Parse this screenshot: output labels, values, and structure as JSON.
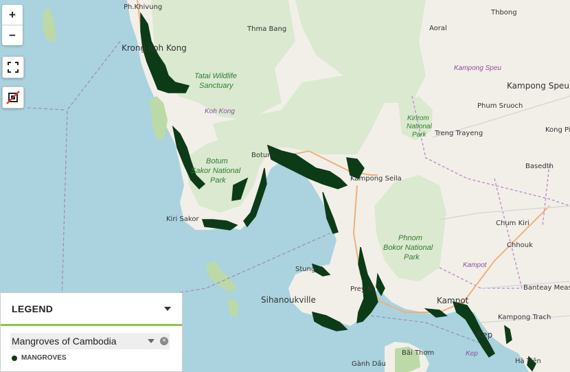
{
  "map": {
    "places": [
      {
        "id": "ph-khivung",
        "label": "Ph.Khivung"
      },
      {
        "id": "thbong",
        "label": "Thbong"
      },
      {
        "id": "thma-bang",
        "label": "Thma Bang"
      },
      {
        "id": "aoral",
        "label": "Aoral"
      },
      {
        "id": "koh-kong-town",
        "label": "Krong Koh Kong"
      },
      {
        "id": "kampong-speu",
        "label": "Kampong Speu"
      },
      {
        "id": "phum-sruoch",
        "label": "Phum Sruoch"
      },
      {
        "id": "treng-trayeng",
        "label": "Treng Trayeng"
      },
      {
        "id": "kong-pisei",
        "label": "Kong Pi"
      },
      {
        "id": "basedth",
        "label": "Basedth"
      },
      {
        "id": "botum",
        "label": "Botum"
      },
      {
        "id": "kampong-seila",
        "label": "Kampong Seila"
      },
      {
        "id": "kiri-sakor",
        "label": "Kiri Sakor"
      },
      {
        "id": "chum-kiri",
        "label": "Chum Kiri"
      },
      {
        "id": "chhouk",
        "label": "Chhouk"
      },
      {
        "id": "stung-hav",
        "label": "Stung H"
      },
      {
        "id": "sihanoukville",
        "label": "Sihanoukville"
      },
      {
        "id": "prey-nob",
        "label": "Prey N"
      },
      {
        "id": "banteay-meas",
        "label": "Banteay Meas"
      },
      {
        "id": "kampot-town",
        "label": "Kampot"
      },
      {
        "id": "kampong-trach",
        "label": "Kampong Trach"
      },
      {
        "id": "kep",
        "label": "Kep"
      },
      {
        "id": "ganh-dau",
        "label": "Gành Dầu"
      },
      {
        "id": "bai-thom",
        "label": "Bãi Thơm"
      },
      {
        "id": "ha-tien",
        "label": "Hà Tiên"
      }
    ],
    "parks": {
      "tatai_1": "Tatai Wildlife",
      "tatai_2": "Sanctuary",
      "kirirom_1": "Kirirom",
      "kirirom_2": "National",
      "kirirom_3": "Park",
      "botum_1": "Botum",
      "botum_2": "Sakor National",
      "botum_3": "Park",
      "phnom_1": "Phnom",
      "phnom_2": "Bokor National",
      "phnom_3": "Park"
    },
    "provinces": {
      "kampong_speu": "Kampong Speu",
      "koh_kong": "Koh Kong",
      "kampot": "Kampot",
      "kep": "Kep"
    }
  },
  "controls": {
    "zoom_in": "+",
    "zoom_out": "−"
  },
  "legend": {
    "title": "LEGEND",
    "layer_name": "Mangroves of Cambodia",
    "remove_glyph": "×",
    "items": [
      {
        "label": "MANGROVES",
        "color": "#0c3b18"
      }
    ]
  }
}
